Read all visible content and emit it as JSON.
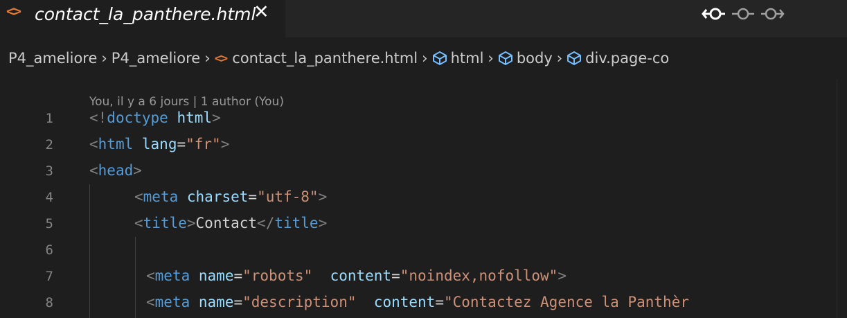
{
  "tab": {
    "icon": "<>",
    "title": "contact_la_panthere.html",
    "close": "✕"
  },
  "tab_actions": [
    "git-compare-previous-icon",
    "git-commit-icon",
    "git-compare-next-icon"
  ],
  "breadcrumb": {
    "items": [
      {
        "label": "P4_ameliore",
        "icon": null
      },
      {
        "label": "P4_ameliore",
        "icon": null
      },
      {
        "label": "contact_la_panthere.html",
        "icon": "<>"
      },
      {
        "label": "html",
        "icon": "symbol-element-icon"
      },
      {
        "label": "body",
        "icon": "symbol-element-icon"
      },
      {
        "label": "div.page-co",
        "icon": "symbol-element-icon"
      }
    ],
    "separator": "›"
  },
  "blame": "You, il y a 6 jours | 1 author (You)",
  "code_lines": [
    {
      "number": "1",
      "parts": [
        [
          "p",
          "<!"
        ],
        [
          "t",
          "doctype"
        ],
        [
          "w",
          " "
        ],
        [
          "a",
          "html"
        ],
        [
          "p",
          ">"
        ]
      ]
    },
    {
      "number": "2",
      "parts": [
        [
          "p",
          "<"
        ],
        [
          "t",
          "html"
        ],
        [
          "w",
          " "
        ],
        [
          "a",
          "lang"
        ],
        [
          "w",
          "="
        ],
        [
          "s",
          "\"fr\""
        ],
        [
          "p",
          ">"
        ]
      ]
    },
    {
      "number": "3",
      "parts": [
        [
          "p",
          "<"
        ],
        [
          "t",
          "head"
        ],
        [
          "p",
          ">"
        ]
      ]
    },
    {
      "number": "4",
      "parts": [
        [
          "p",
          "<"
        ],
        [
          "t",
          "meta"
        ],
        [
          "w",
          " "
        ],
        [
          "a",
          "charset"
        ],
        [
          "w",
          "="
        ],
        [
          "s",
          "\"utf-8\""
        ],
        [
          "p",
          ">"
        ]
      ]
    },
    {
      "number": "5",
      "parts": [
        [
          "p",
          "<"
        ],
        [
          "t",
          "title"
        ],
        [
          "p",
          ">"
        ],
        [
          "w",
          "Contact"
        ],
        [
          "p",
          "</"
        ],
        [
          "t",
          "title"
        ],
        [
          "p",
          ">"
        ]
      ]
    },
    {
      "number": "6",
      "parts": []
    },
    {
      "number": "7",
      "parts": [
        [
          "p",
          "<"
        ],
        [
          "t",
          "meta"
        ],
        [
          "w",
          " "
        ],
        [
          "a",
          "name"
        ],
        [
          "w",
          "="
        ],
        [
          "s",
          "\"robots\""
        ],
        [
          "w",
          "  "
        ],
        [
          "a",
          "content"
        ],
        [
          "w",
          "="
        ],
        [
          "s",
          "\"noindex,nofollow\""
        ],
        [
          "p",
          ">"
        ]
      ]
    },
    {
      "number": "8",
      "parts": [
        [
          "p",
          "<"
        ],
        [
          "t",
          "meta"
        ],
        [
          "w",
          " "
        ],
        [
          "a",
          "name"
        ],
        [
          "w",
          "="
        ],
        [
          "s",
          "\"description\""
        ],
        [
          "w",
          "  "
        ],
        [
          "a",
          "content"
        ],
        [
          "w",
          "="
        ],
        [
          "s",
          "\"Contactez Agence la Panthèr"
        ]
      ]
    }
  ],
  "colors": {
    "background": "#1e1e1e",
    "tab_bar": "#252526",
    "tag": "#569cd6",
    "attribute": "#9cdcfe",
    "string": "#ce9178",
    "punctuation": "#808080",
    "text": "#d4d4d4",
    "html_icon": "#e37933",
    "symbol_icon": "#75beff"
  }
}
